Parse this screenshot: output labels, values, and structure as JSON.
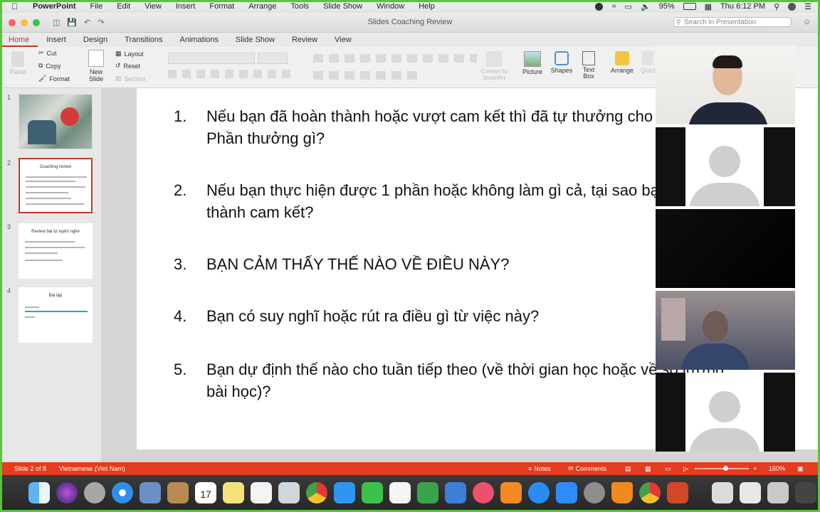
{
  "menubar": {
    "app": "PowerPoint",
    "items": [
      "File",
      "Edit",
      "View",
      "Insert",
      "Format",
      "Arrange",
      "Tools",
      "Slide Show",
      "Window",
      "Help"
    ],
    "battery": "95%",
    "clock": "Thu 6:12 PM"
  },
  "window": {
    "title": "Slides Coaching Review",
    "search_placeholder": "Search in Presentation"
  },
  "ribbon_tabs": [
    "Home",
    "Insert",
    "Design",
    "Transitions",
    "Animations",
    "Slide Show",
    "Review",
    "View"
  ],
  "ribbon": {
    "paste": "Paste",
    "cut": "Cut",
    "copy": "Copy",
    "format": "Format",
    "new_slide": "New Slide",
    "layout": "Layout",
    "reset": "Reset",
    "section": "Section",
    "convert_smartart": "Convert to SmartArt",
    "picture": "Picture",
    "shapes": "Shapes",
    "text_box": "Text Box",
    "arrange": "Arrange",
    "quick_styles": "Quick Styles"
  },
  "thumbnails": [
    {
      "num": "1",
      "title": ""
    },
    {
      "num": "2",
      "title": "Coaching review"
    },
    {
      "num": "3",
      "title": "Review bài tự luyện nghe"
    },
    {
      "num": "4",
      "title": "Bài tập"
    }
  ],
  "slide": {
    "questions": [
      {
        "num": "1.",
        "text": "Nếu bạn đã hoàn thành hoặc vượt cam kết thì đã tự thưởng cho mình chưa? Phần thưởng gì?"
      },
      {
        "num": "2.",
        "text": "Nếu bạn thực hiện được 1 phần hoặc không làm gì cả, tại sao bạn chưa hoàn thành cam kết?"
      },
      {
        "num": "3.",
        "text": "BẠN CẢM THẤY THẾ NÀO VỀ ĐIỀU NÀY?"
      },
      {
        "num": "4.",
        "text": "Bạn có suy nghĩ hoặc rút ra điều gì từ việc này?"
      },
      {
        "num": "5.",
        "text": "Bạn dự định thế nào cho tuần tiếp theo (về thời gian học hoặc về số lượng bài học)?"
      }
    ]
  },
  "statusbar": {
    "slide_info": "Slide 2 of 8",
    "language": "Vietnamese (Viet Nam)",
    "notes": "Notes",
    "comments": "Comments",
    "zoom": "160%"
  },
  "dock": {
    "calendar_day": "17"
  },
  "colors": {
    "accent": "#c0392b",
    "status_bar": "#e53b1f",
    "frame": "#53c935"
  }
}
